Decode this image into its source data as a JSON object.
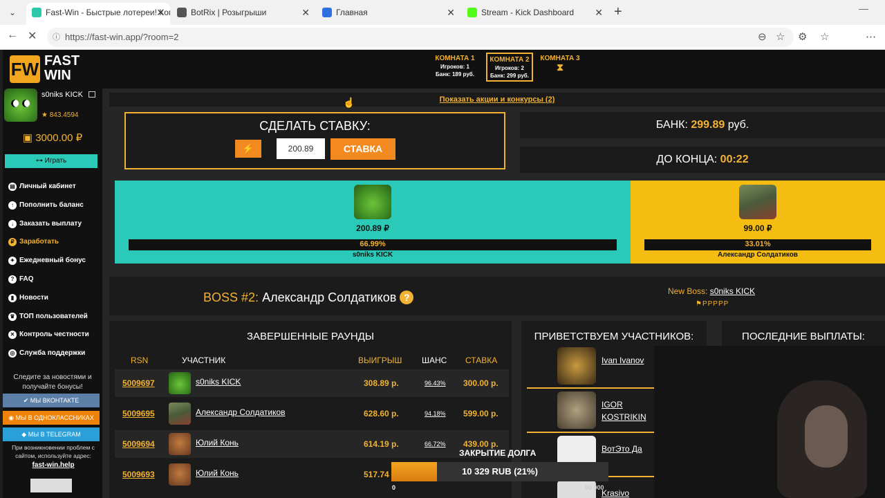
{
  "browser": {
    "tabs": [
      {
        "title": "Fast-Win - Быстрые лотереи! Ком",
        "fav_color": "#2bc9a9"
      },
      {
        "title": "BotRix | Розыгрыши",
        "fav_color": "#555555"
      },
      {
        "title": "Главная",
        "fav_color": "#2f6fe0"
      },
      {
        "title": "Stream - Kick Dashboard",
        "fav_color": "#53fc18"
      }
    ],
    "url": "https://fast-win.app/?room=2"
  },
  "logo": {
    "mark": "FW",
    "line1": "FAST",
    "line2": "WIN"
  },
  "user": {
    "name": "s0niks KICK",
    "rating": "★ 843.4594",
    "balance": "3000.00 ₽"
  },
  "sidebar": {
    "play_label": "Играть",
    "menu": [
      {
        "label": "Личный кабинет",
        "icon": "▤"
      },
      {
        "label": "Пополнить баланс",
        "icon": "↑"
      },
      {
        "label": "Заказать выплату",
        "icon": "↓"
      },
      {
        "label": "Заработать",
        "icon": "₽"
      },
      {
        "label": "Ежедневный бонус",
        "icon": "✦"
      },
      {
        "label": "FAQ",
        "icon": "?"
      },
      {
        "label": "Новости",
        "icon": "▮"
      },
      {
        "label": "ТОП пользователей",
        "icon": "♛"
      },
      {
        "label": "Контроль честности",
        "icon": "✕"
      },
      {
        "label": "Служба поддержки",
        "icon": "◎"
      }
    ],
    "news_text": "Следите за новостями и получайте бонусы!",
    "vk": "МЫ ВКОНТАКТЕ",
    "ok": "МЫ В ОДНОКЛАССНИКАХ",
    "tg": "МЫ В TELEGRAM",
    "help_text": "При возникновении проблем с сайтом, используйте адрес:",
    "help_link": "fast-win.help"
  },
  "rooms": [
    {
      "title": "КОМНАТА 1",
      "players": "Игроков: 1",
      "bank": "Банк: 189 руб."
    },
    {
      "title": "КОМНАТА 2",
      "players": "Игроков: 2",
      "bank": "Банк: 299 руб."
    },
    {
      "title": "КОМНАТА 3"
    }
  ],
  "promo_link": "Показать акции и конкурсы (2)",
  "bet": {
    "title": "СДЕЛАТЬ СТАВКУ:",
    "value": "200.89",
    "button": "СТАВКА"
  },
  "bank": {
    "label": "БАНК:",
    "value": "299.89",
    "unit": "руб."
  },
  "timer": {
    "label": "ДО КОНЦА:",
    "value": "00:22"
  },
  "players": [
    {
      "amount": "200.89 ₽",
      "percent": "66.99%",
      "share": 0.6699,
      "name": "s0niks KICK",
      "color": "#2bc9b7"
    },
    {
      "amount": "99.00 ₽",
      "percent": "33.01%",
      "share": 0.3301,
      "name": "Александр Солдатиков",
      "color": "#f5bd12"
    }
  ],
  "boss": {
    "number": "BOSS #2:",
    "name": "Александр Солдатиков",
    "new_label": "New Boss:",
    "new_name": "s0niks KICK",
    "flags": "⚑PPPPP"
  },
  "rounds": {
    "title": "ЗАВЕРШЕННЫЕ РАУНДЫ",
    "headers": [
      "RSN",
      "УЧАСТНИК",
      "ВЫИГРЫШ",
      "ШАНС",
      "СТАВКА"
    ],
    "rows": [
      {
        "id": "5009697",
        "name": "s0niks KICK",
        "win": "308.89 р.",
        "chance": "96.43%",
        "bet": "300.00 р."
      },
      {
        "id": "5009695",
        "name": "Александр Солдатиков",
        "win": "628.60 р.",
        "chance": "94.18%",
        "bet": "599.00 р."
      },
      {
        "id": "5009694",
        "name": "Юлий Конь",
        "win": "614.19 р.",
        "chance": "66.72%",
        "bet": "439.00 р."
      },
      {
        "id": "5009693",
        "name": "Юлий Конь",
        "win": "517.74",
        "chance": "",
        "bet": ""
      }
    ]
  },
  "welcome": {
    "title": "ПРИВЕТСТВУЕМ УЧАСТНИКОВ:",
    "users": [
      "Ivan Ivanov",
      "IGOR KOSTRIKIN",
      "ВотЭто Да",
      "Krasivo"
    ]
  },
  "payouts": {
    "title": "ПОСЛЕДНИЕ ВЫПЛАТЫ:"
  },
  "debt": {
    "label": "ЗАКРЫТИЕ ДОЛГА",
    "text": "10 329 RUB (21%)",
    "fraction": 0.21,
    "start": "0",
    "goal": "50 000"
  }
}
